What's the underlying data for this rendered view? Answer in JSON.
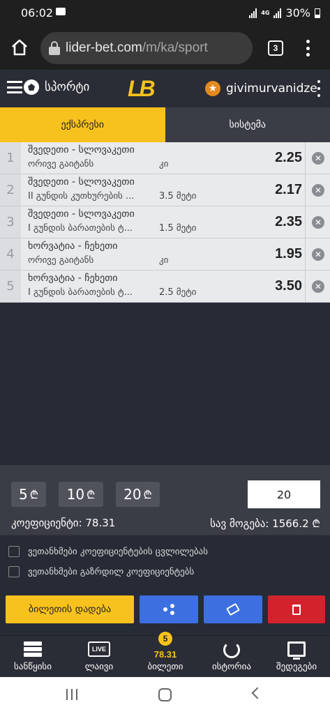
{
  "status_bar": {
    "time": "06:02",
    "network": "4G",
    "battery": "30%"
  },
  "browser": {
    "url_host": "lider-bet.com",
    "url_path": "/m/ka/sport",
    "tab_count": "3"
  },
  "header": {
    "sport_label": "სპორტი",
    "logo": "LB",
    "username": "givimurvanidze"
  },
  "bet_type_tabs": [
    {
      "label": "ექსპრესი",
      "active": true
    },
    {
      "label": "სისტემა",
      "active": false
    }
  ],
  "bets": [
    {
      "num": "1",
      "match": "შვედეთი - სლოვაკეთი",
      "market": "ორივე გაიტანს",
      "outcome": "კი",
      "odd": "2.25"
    },
    {
      "num": "2",
      "match": "შვედეთი - სლოვაკეთი",
      "market": "II გუნდის კუთხურების ...",
      "outcome": "3.5 მეტი",
      "odd": "2.17"
    },
    {
      "num": "3",
      "match": "შვედეთი - სლოვაკეთი",
      "market": "I გუნდის ბარათების ტ...",
      "outcome": "1.5 მეტი",
      "odd": "2.35"
    },
    {
      "num": "4",
      "match": "ხორვატია - ჩეხეთი",
      "market": "ორივე გაიტანს",
      "outcome": "კი",
      "odd": "1.95"
    },
    {
      "num": "5",
      "match": "ხორვატია - ჩეხეთი",
      "market": "I გუნდის ბარათების ტ...",
      "outcome": "2.5 მეტი",
      "odd": "3.50"
    }
  ],
  "stake": {
    "quick_amounts": [
      "5",
      "10",
      "20"
    ],
    "currency_symbol": "₾",
    "input_value": "20",
    "coefficient_label": "კოეფიციენტი: 78.31",
    "total_win_label": "სავ მოგება: 1566.2 ₾"
  },
  "options": [
    "ვეთანხმები კოეფიციენტების ცვლილებას",
    "ვეთანხმები გაზრდილ კოეფიციენტებს"
  ],
  "actions": {
    "place_label": "ბილეთის დადება"
  },
  "bottom_nav": [
    {
      "label": "სანწყისი",
      "icon": "sports-list-icon"
    },
    {
      "label": "ლაივი",
      "icon": "live-icon",
      "icon_text": "LIVE"
    },
    {
      "label": "ბილეთი",
      "icon": "ticket-icon",
      "badge": "5",
      "coef": "78.31"
    },
    {
      "label": "ისტორია",
      "icon": "history-icon"
    },
    {
      "label": "შედეგები",
      "icon": "monitor-icon"
    }
  ],
  "colors": {
    "accent": "#f7c21d",
    "primary_blue": "#3d6fe0",
    "danger": "#d2232c",
    "background": "#272b36"
  }
}
